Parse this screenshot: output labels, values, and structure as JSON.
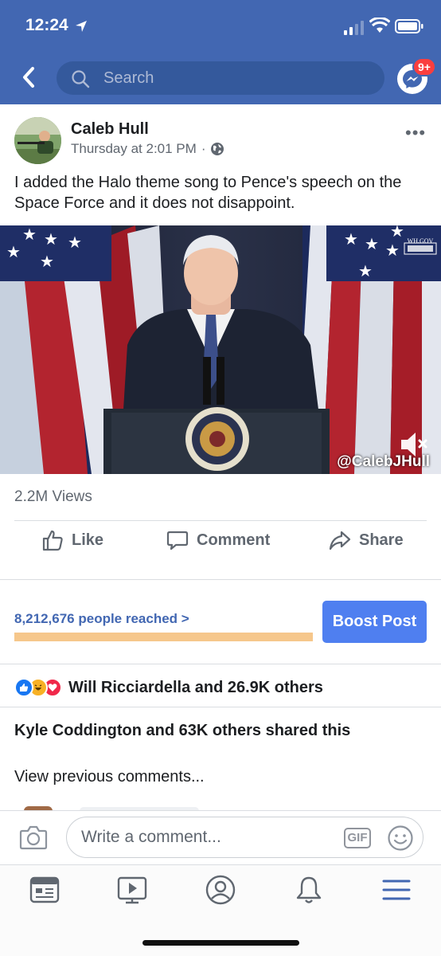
{
  "status_bar": {
    "time": "12:24"
  },
  "header": {
    "search_placeholder": "Search",
    "messenger_badge": "9+"
  },
  "post": {
    "author": "Caleb Hull",
    "timestamp": "Thursday at 2:01 PM",
    "privacy_separator": "·",
    "text": "I added the Halo theme song to Pence's speech on the Space Force and it does not disappoint.",
    "video": {
      "watermark": "@CalebJHull",
      "seal_text": "WH.GOV",
      "muted": true
    },
    "views": "2.2M Views",
    "actions": {
      "like": "Like",
      "comment": "Comment",
      "share": "Share"
    },
    "reach": {
      "text": "8,212,676 people reached",
      "chevron": ">",
      "boost_label": "Boost Post"
    },
    "reactions_text": "Will Ricciardella and 26.9K others",
    "shares_text": "Kyle Coddington and 63K others shared this",
    "view_previous": "View previous comments..."
  },
  "comment_bar": {
    "placeholder": "Write a comment...",
    "gif_label": "GIF"
  },
  "tabbar": {
    "items": [
      "news-feed",
      "watch",
      "profile",
      "notifications",
      "menu"
    ],
    "active": "menu"
  },
  "colors": {
    "brand": "#4267b2",
    "boost": "#4f7ff0",
    "reach_bar": "#f6c78b",
    "badge": "#fa3e3e"
  }
}
